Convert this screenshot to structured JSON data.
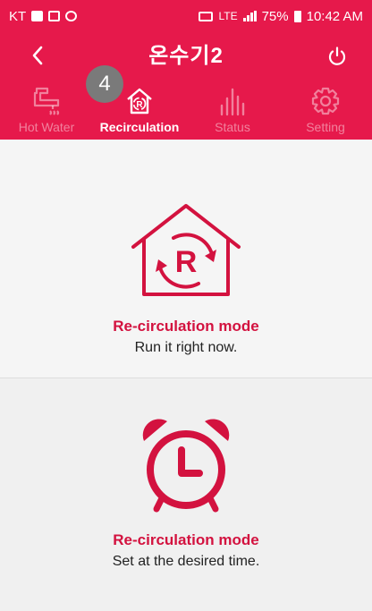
{
  "status_bar": {
    "carrier": "KT",
    "network": "LTE",
    "battery": "75%",
    "time": "10:42 AM"
  },
  "header": {
    "title": "온수기2",
    "back_icon": "chevron-left-icon",
    "power_icon": "power-icon"
  },
  "tabs": [
    {
      "label": "Hot Water",
      "icon": "faucet-icon",
      "active": false
    },
    {
      "label": "Recirculation",
      "icon": "house-recirculation-icon",
      "active": true
    },
    {
      "label": "Status",
      "icon": "bar-chart-icon",
      "active": false
    },
    {
      "label": "Setting",
      "icon": "gear-icon",
      "active": false
    }
  ],
  "step_badge": "4",
  "cards": [
    {
      "title": "Re-circulation mode",
      "subtitle": "Run it right now.",
      "icon": "house-recirculation-icon"
    },
    {
      "title": "Re-circulation mode",
      "subtitle": "Set at the desired time.",
      "icon": "alarm-clock-icon"
    }
  ],
  "colors": {
    "brand": "#e6194b",
    "accent_text": "#d3123f",
    "badge": "#7a7a7a"
  }
}
